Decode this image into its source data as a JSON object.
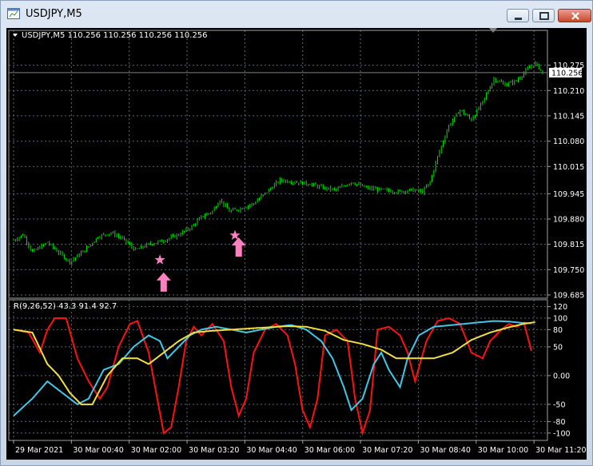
{
  "window": {
    "title": "USDJPY,M5"
  },
  "main_chart": {
    "header": "USDJPY,M5  110.256 110.256 110.256 110.256",
    "current_price": "110.256",
    "price_ticks": [
      "110.275",
      "110.210",
      "110.145",
      "110.080",
      "110.015",
      "109.945",
      "109.880",
      "109.815",
      "109.750",
      "109.685"
    ]
  },
  "indicator": {
    "header": "R(9,26,52) 43.3 91.4 92.7",
    "ticks": [
      "120",
      "100",
      "80",
      "50",
      "0.00",
      "-50",
      "-80",
      "-100"
    ]
  },
  "time_axis": {
    "labels": [
      "29 Mar 2021",
      "30 Mar 00:40",
      "30 Mar 02:00",
      "30 Mar 03:20",
      "30 Mar 04:40",
      "30 Mar 06:00",
      "30 Mar 07:20",
      "30 Mar 08:40",
      "30 Mar 10:00",
      "30 Mar 11:20"
    ]
  },
  "colors": {
    "candle": "#00e000",
    "arrow": "#ff80c0",
    "r_fast": "#ff1010",
    "r_mid": "#40c8e8",
    "r_slow": "#f0e040",
    "grid": "#5a6a70"
  },
  "icons": {
    "app": "chart-window-icon",
    "minimize": "minimize-icon",
    "maximize": "restore-icon",
    "close": "close-icon"
  },
  "chart_data": [
    {
      "type": "candlestick",
      "title": "USDJPY,M5",
      "ylim": [
        109.685,
        110.305
      ],
      "x": [
        "29 Mar 2021",
        "30 Mar 00:40",
        "30 Mar 02:00",
        "30 Mar 03:20",
        "30 Mar 04:40",
        "30 Mar 06:00",
        "30 Mar 07:20",
        "30 Mar 08:40",
        "30 Mar 10:00",
        "30 Mar 11:20"
      ],
      "close_path": [
        [
          0,
          109.825
        ],
        [
          5,
          109.84
        ],
        [
          10,
          109.795
        ],
        [
          18,
          109.82
        ],
        [
          25,
          109.79
        ],
        [
          30,
          109.77
        ],
        [
          38,
          109.8
        ],
        [
          45,
          109.835
        ],
        [
          52,
          109.845
        ],
        [
          58,
          109.83
        ],
        [
          65,
          109.8
        ],
        [
          72,
          109.815
        ],
        [
          80,
          109.825
        ],
        [
          88,
          109.84
        ],
        [
          95,
          109.86
        ],
        [
          100,
          109.885
        ],
        [
          106,
          109.9
        ],
        [
          110,
          109.93
        ],
        [
          115,
          109.9
        ],
        [
          120,
          109.905
        ],
        [
          128,
          109.92
        ],
        [
          135,
          109.95
        ],
        [
          142,
          109.98
        ],
        [
          150,
          109.975
        ],
        [
          158,
          109.97
        ],
        [
          165,
          109.96
        ],
        [
          172,
          109.955
        ],
        [
          180,
          109.975
        ],
        [
          188,
          109.96
        ],
        [
          196,
          109.955
        ],
        [
          205,
          109.95
        ],
        [
          212,
          109.955
        ],
        [
          218,
          109.95
        ],
        [
          222,
          109.975
        ],
        [
          226,
          110.04
        ],
        [
          232,
          110.12
        ],
        [
          238,
          110.16
        ],
        [
          244,
          110.135
        ],
        [
          250,
          110.18
        ],
        [
          256,
          110.24
        ],
        [
          262,
          110.225
        ],
        [
          268,
          110.235
        ],
        [
          274,
          110.265
        ],
        [
          278,
          110.28
        ],
        [
          282,
          110.256
        ]
      ],
      "n_bars": 282,
      "markers": [
        {
          "type": "star",
          "x": 78,
          "y": 109.775
        },
        {
          "type": "up-arrow",
          "x": 80,
          "y": 109.718
        },
        {
          "type": "star",
          "x": 118,
          "y": 109.838
        },
        {
          "type": "up-arrow",
          "x": 120,
          "y": 109.808
        }
      ]
    },
    {
      "type": "line",
      "title": "R(9,26,52) 43.3 91.4 92.7",
      "ylim": [
        -110,
        125
      ],
      "series": [
        {
          "name": "R(9)",
          "values": [
            [
              0,
              80
            ],
            [
              8,
              75
            ],
            [
              14,
              40
            ],
            [
              18,
              80
            ],
            [
              22,
              100
            ],
            [
              28,
              100
            ],
            [
              34,
              30
            ],
            [
              40,
              -10
            ],
            [
              46,
              -40
            ],
            [
              50,
              -20
            ],
            [
              56,
              50
            ],
            [
              62,
              90
            ],
            [
              66,
              95
            ],
            [
              72,
              40
            ],
            [
              76,
              -30
            ],
            [
              80,
              -100
            ],
            [
              84,
              -90
            ],
            [
              88,
              -20
            ],
            [
              92,
              60
            ],
            [
              96,
              85
            ],
            [
              100,
              70
            ],
            [
              106,
              90
            ],
            [
              112,
              60
            ],
            [
              116,
              -20
            ],
            [
              120,
              -70
            ],
            [
              124,
              -40
            ],
            [
              128,
              40
            ],
            [
              134,
              80
            ],
            [
              140,
              90
            ],
            [
              146,
              70
            ],
            [
              150,
              20
            ],
            [
              154,
              -60
            ],
            [
              158,
              -90
            ],
            [
              162,
              -40
            ],
            [
              166,
              70
            ],
            [
              172,
              80
            ],
            [
              178,
              60
            ],
            [
              182,
              -40
            ],
            [
              186,
              -100
            ],
            [
              190,
              -60
            ],
            [
              194,
              80
            ],
            [
              200,
              85
            ],
            [
              206,
              70
            ],
            [
              210,
              40
            ],
            [
              214,
              -10
            ],
            [
              220,
              60
            ],
            [
              226,
              95
            ],
            [
              232,
              100
            ],
            [
              238,
              90
            ],
            [
              244,
              40
            ],
            [
              250,
              30
            ],
            [
              254,
              60
            ],
            [
              260,
              80
            ],
            [
              264,
              90
            ],
            [
              268,
              85
            ],
            [
              272,
              92
            ],
            [
              276,
              43
            ]
          ]
        },
        {
          "name": "R(26)",
          "values": [
            [
              0,
              -70
            ],
            [
              10,
              -40
            ],
            [
              18,
              -10
            ],
            [
              26,
              -30
            ],
            [
              34,
              -50
            ],
            [
              40,
              -40
            ],
            [
              48,
              10
            ],
            [
              56,
              20
            ],
            [
              64,
              50
            ],
            [
              72,
              70
            ],
            [
              78,
              60
            ],
            [
              82,
              30
            ],
            [
              88,
              50
            ],
            [
              94,
              70
            ],
            [
              100,
              80
            ],
            [
              108,
              85
            ],
            [
              116,
              80
            ],
            [
              124,
              75
            ],
            [
              132,
              80
            ],
            [
              140,
              85
            ],
            [
              148,
              88
            ],
            [
              156,
              80
            ],
            [
              164,
              60
            ],
            [
              170,
              30
            ],
            [
              176,
              -20
            ],
            [
              180,
              -60
            ],
            [
              186,
              -40
            ],
            [
              192,
              20
            ],
            [
              196,
              40
            ],
            [
              200,
              10
            ],
            [
              206,
              -20
            ],
            [
              210,
              30
            ],
            [
              216,
              70
            ],
            [
              224,
              85
            ],
            [
              234,
              88
            ],
            [
              246,
              92
            ],
            [
              256,
              95
            ],
            [
              264,
              94
            ],
            [
              270,
              92
            ],
            [
              276,
              91
            ]
          ]
        },
        {
          "name": "R(52)",
          "values": [
            [
              0,
              80
            ],
            [
              10,
              75
            ],
            [
              18,
              20
            ],
            [
              24,
              0
            ],
            [
              30,
              -30
            ],
            [
              36,
              -50
            ],
            [
              42,
              -50
            ],
            [
              50,
              0
            ],
            [
              58,
              30
            ],
            [
              66,
              30
            ],
            [
              72,
              20
            ],
            [
              80,
              40
            ],
            [
              88,
              60
            ],
            [
              96,
              75
            ],
            [
              106,
              78
            ],
            [
              116,
              80
            ],
            [
              126,
              82
            ],
            [
              136,
              84
            ],
            [
              146,
              86
            ],
            [
              156,
              85
            ],
            [
              166,
              78
            ],
            [
              176,
              62
            ],
            [
              186,
              55
            ],
            [
              196,
              45
            ],
            [
              204,
              30
            ],
            [
              214,
              30
            ],
            [
              224,
              30
            ],
            [
              234,
              40
            ],
            [
              244,
              62
            ],
            [
              254,
              75
            ],
            [
              264,
              84
            ],
            [
              272,
              90
            ],
            [
              278,
              93
            ]
          ]
        }
      ]
    }
  ]
}
